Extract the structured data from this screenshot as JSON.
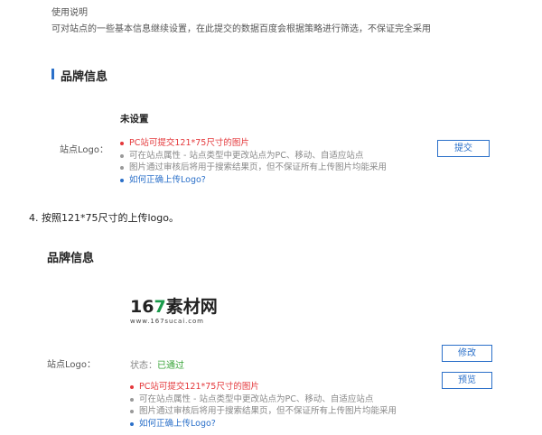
{
  "usage": {
    "heading": "使用说明",
    "description": "可对站点的一些基本信息继续设置，在此提交的数据百度会根据策略进行筛选，不保证完全采用"
  },
  "brand_section_1": {
    "title": "品牌信息",
    "status_title": "未设置",
    "field_label": "站点Logo：",
    "bullets": [
      "PC站可提交121*75尺寸的图片",
      "可在站点属性 - 站点类型中更改站点为PC、移动、自适应站点",
      "图片通过审核后将用于搜索结果页，但不保证所有上传图片均能采用",
      "如何正确上传Logo?"
    ],
    "submit_label": "提交"
  },
  "step": {
    "text": "4. 按照121*75尺寸的上传logo。"
  },
  "brand_section_2": {
    "title": "品牌信息",
    "logo": {
      "digits_1": "16",
      "digit_7": "7",
      "word": "素材网",
      "url": "www.167sucai.com"
    },
    "field_label": "站点Logo：",
    "status_label": "状态：",
    "status_value": "已通过",
    "bullets": [
      "PC站可提交121*75尺寸的图片",
      "可在站点属性 - 站点类型中更改站点为PC、移动、自适应站点",
      "图片通过审核后将用于搜索结果页，但不保证所有上传图片均能采用",
      "如何正确上传Logo?"
    ],
    "modify_label": "修改",
    "preview_label": "预览"
  },
  "colors": {
    "accent": "#2b70c9",
    "warning": "#e4393c",
    "success": "#3aa53a",
    "logo_accent": "#1a9b4b"
  }
}
